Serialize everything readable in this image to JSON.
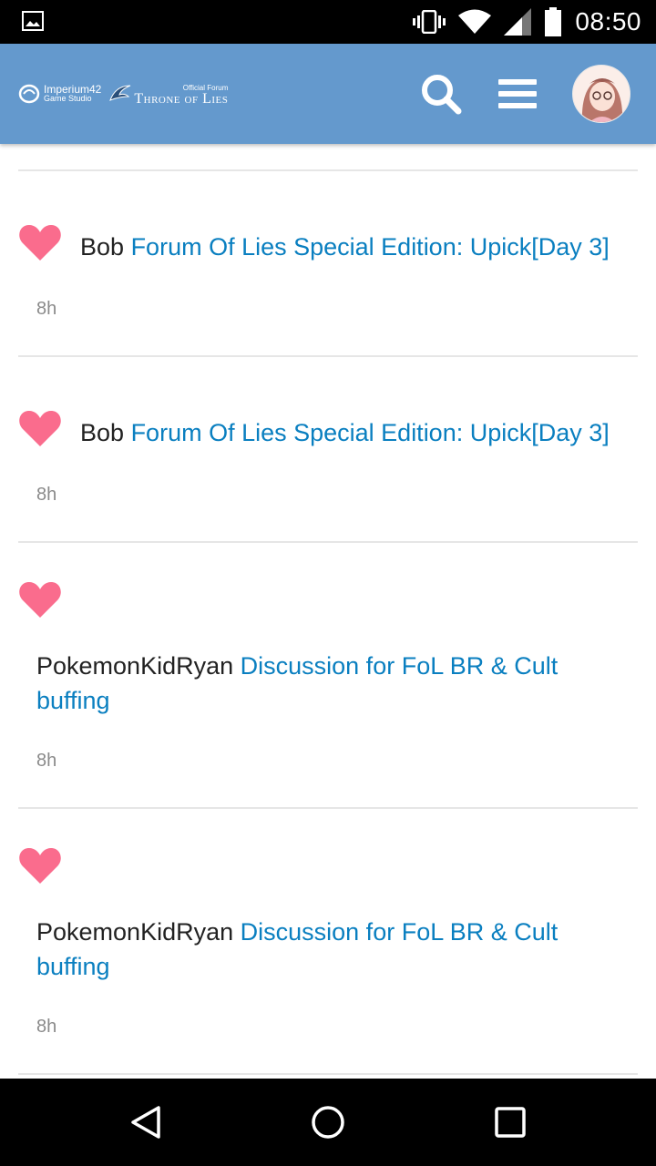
{
  "status_bar": {
    "time": "08:50",
    "icons": [
      "gallery-icon",
      "vibrate-icon",
      "wifi-icon",
      "cell-signal-icon",
      "battery-icon"
    ]
  },
  "header": {
    "studio_name": "Imperium42",
    "studio_sub": "Game Studio",
    "forum_sub": "Official Forum",
    "forum_name": "Throne of Lies",
    "colors": {
      "header_bg": "#6499cd",
      "link": "#0a7fc0",
      "heart": "#fa6c8d"
    },
    "icons": [
      "search-icon",
      "hamburger-menu-icon",
      "user-avatar"
    ]
  },
  "notifications": [
    {
      "icon": "heart-icon",
      "user": "Bob",
      "topic": "Forum Of Lies Special Edition: Upick[Day 3]",
      "time": "8h"
    },
    {
      "icon": "heart-icon",
      "user": "Bob",
      "topic": "Forum Of Lies Special Edition: Upick[Day 3]",
      "time": "8h"
    },
    {
      "icon": "heart-icon",
      "user": "PokemonKidRyan",
      "topic": "Discussion for FoL BR & Cult",
      "topic_cont": "buffing",
      "time": "8h"
    },
    {
      "icon": "heart-icon",
      "user": "PokemonKidRyan",
      "topic": "Discussion for FoL BR & Cult",
      "topic_cont": "buffing",
      "time": "8h"
    }
  ],
  "nav_bar": {
    "icons": [
      "back-icon",
      "home-icon",
      "recents-icon"
    ]
  }
}
